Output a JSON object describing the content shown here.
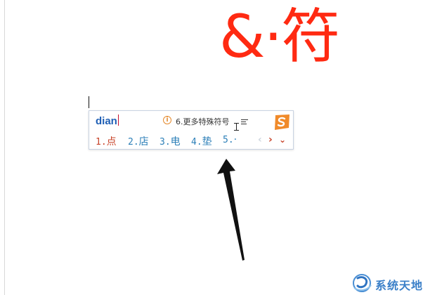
{
  "document": {
    "big_title": "&·符"
  },
  "ime": {
    "pinyin": "dian",
    "tip_icon_glyph": "i",
    "tip_text": "6.更多特殊符号",
    "logo_icon": "sogou-logo-icon",
    "candidates": [
      {
        "index": "1.",
        "char": "点"
      },
      {
        "index": "2.",
        "char": "店"
      },
      {
        "index": "3.",
        "char": "电"
      },
      {
        "index": "4.",
        "char": "垫"
      },
      {
        "index": "5.",
        "char": "·"
      }
    ],
    "nav": {
      "prev": "‹",
      "next": "›",
      "more": "⌄"
    },
    "colors": {
      "pinyin": "#1f5fb5",
      "selected": "#c8442a",
      "candidate": "#2c7fb8",
      "accent": "#e58a2d"
    }
  },
  "watermark": {
    "text": "系统天地"
  },
  "colors": {
    "title": "#ff2a12",
    "arrow": "#111111"
  }
}
